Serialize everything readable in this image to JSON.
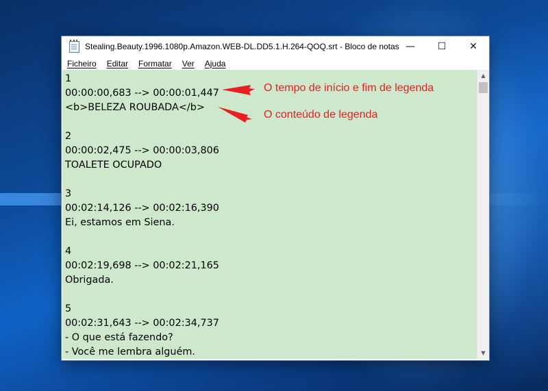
{
  "window": {
    "title": "Stealing.Beauty.1996.1080p.Amazon.WEB-DL.DD5.1.H.264-QOQ.srt - Bloco de notas",
    "controls": {
      "minimize": "—",
      "maximize": "☐",
      "close": "✕"
    }
  },
  "menu": [
    "Ficheiro",
    "Editar",
    "Formatar",
    "Ver",
    "Ajuda"
  ],
  "editor": {
    "background": "#cde8cd",
    "lines": [
      "1",
      "00:00:00,683 --> 00:00:01,447",
      "<b>BELEZA ROUBADA</b>",
      "",
      "2",
      "00:00:02,475 --> 00:00:03,806",
      "TOALETE OCUPADO",
      "",
      "3",
      "00:02:14,126 --> 00:02:16,390",
      "Ei, estamos em Siena.",
      "",
      "4",
      "00:02:19,698 --> 00:02:21,165",
      "Obrigada.",
      "",
      "5",
      "00:02:31,643 --> 00:02:34,737",
      "- O que está fazendo?",
      "- Você me lembra alguém."
    ]
  },
  "annotations": {
    "color": "#e8201f",
    "timing": "O tempo de início e fim de legenda",
    "content": "O conteúdo de legenda"
  }
}
